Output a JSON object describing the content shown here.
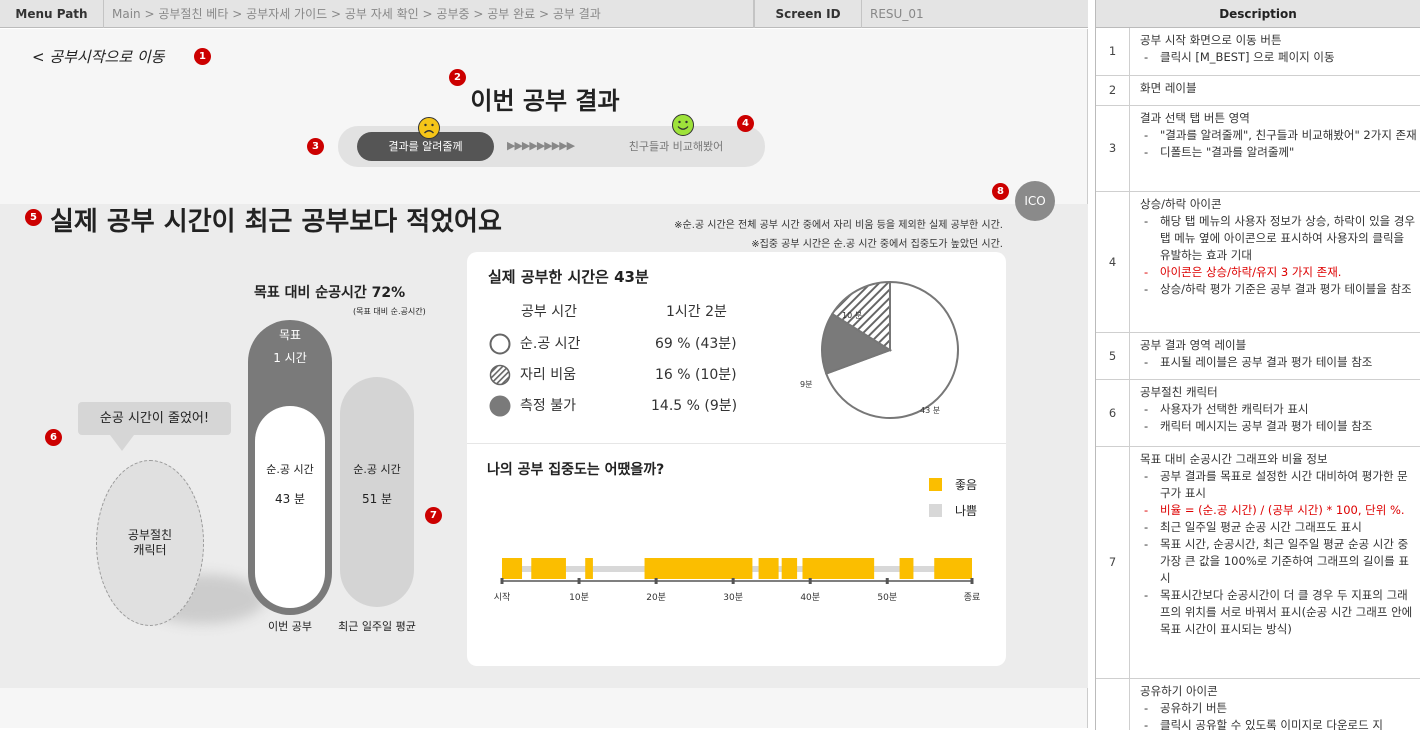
{
  "header": {
    "menu_path_label": "Menu Path",
    "menu_path": "Main > 공부절친 베타 > 공부자세 가이드 > 공부 자세 확인 > 공부중 > 공부 완료 > 공부 결과",
    "screen_id_label": "Screen ID",
    "screen_id": "RESU_01"
  },
  "screen": {
    "back_link": "< 공부시작으로 이동",
    "title": "이번 공부 결과",
    "tab_result": "결과를 알려줄께",
    "tab_arrows": "▶▶▶▶▶▶▶▶▶",
    "tab_compare": "친구들과 비교해봤어",
    "icon_label": "ICO",
    "result_heading": "실제 공부 시간이 최근 공부보다 적었어요",
    "note1": "※순.공 시간은 전체 공부 시간 중에서 자리 비움 등을 제외한 실제 공부한 시간.",
    "note2": "※집중 공부 시간은 순.공 시간 중에서 집중도가 높았던 시간.",
    "speech": "순공 시간이 줄었어!",
    "character": "공부절친\n캐릭터",
    "goal_ratio_prefix": "목표 대비 순공시간 ",
    "goal_ratio": "72%",
    "goal_ratio_sub": "(목표 대비 순.공시간)",
    "goal_label": "목표",
    "goal_value": "1 시간",
    "inner_label": "순.공 시간",
    "inner_value": "43 분",
    "avg_label": "순.공 시간",
    "avg_value": "51 분",
    "bar1_caption": "이번 공부",
    "bar2_caption": "최근 일주일 평균",
    "goal_ratio_value": 0.72,
    "actual_prefix": "실제 공부한 시간은 ",
    "actual_value": "43분",
    "study_time_label": "공부 시간",
    "study_time_value": "1시간 2분",
    "stats": [
      {
        "icon": "empty-circle",
        "label": "순.공 시간",
        "value": "69 % (43분)"
      },
      {
        "icon": "hatched-circle",
        "label": "자리 비움",
        "value": "16 % (10분)"
      },
      {
        "icon": "filled-circle",
        "label": "측정 불가",
        "value": "14.5 % (9분)"
      }
    ],
    "pie_labels": {
      "hatched": "10 분",
      "filled": "9분",
      "empty": "43 분"
    },
    "focus_heading": "나의 공부 집중도는 어땠을까?",
    "legend_good": "좋음",
    "legend_bad": "나쁨",
    "ticks": [
      "시작",
      "10분",
      "20분",
      "30분",
      "40분",
      "50분",
      "종료"
    ]
  },
  "colors": {
    "good": "#fbbe00",
    "bad": "#d8d8d8",
    "marker": "#cc0000",
    "dark": "#555555"
  },
  "chart_data": [
    {
      "type": "pie",
      "values": [
        43,
        10,
        9
      ],
      "categories": [
        "순.공 시간",
        "자리 비움",
        "측정 불가"
      ],
      "labels": [
        "43 분",
        "10 분",
        "9분"
      ]
    },
    {
      "type": "bar",
      "x_ticks": [
        "시작",
        "10분",
        "20분",
        "30분",
        "40분",
        "50분",
        "종료"
      ],
      "good_segments_min": [
        [
          0,
          2.6
        ],
        [
          3.8,
          8.3
        ],
        [
          10.8,
          11.8
        ],
        [
          18.5,
          32.5
        ],
        [
          33.3,
          35.9
        ],
        [
          36.3,
          38.3
        ],
        [
          39,
          48.3
        ],
        [
          51.6,
          53.4
        ],
        [
          56.1,
          61
        ]
      ]
    }
  ],
  "desc": {
    "header": "Description",
    "rows": [
      {
        "n": "1",
        "title": "공부 시작 화면으로 이동 버튼",
        "items": [
          {
            "t": "클릭시 [M_BEST] 으로 페이지 이동",
            "c": ""
          }
        ]
      },
      {
        "n": "2",
        "title": "화면 레이블",
        "items": []
      },
      {
        "n": "3",
        "title": "결과 선택 탭 버튼 영역",
        "items": [
          {
            "t": "\"결과를 알려줄께\", 친구들과 비교해봤어\" 2가지 존재",
            "c": ""
          },
          {
            "t": "디폴트는 \"결과를 알려줄께\"",
            "c": ""
          }
        ]
      },
      {
        "n": "4",
        "title": "상승/하락 아이콘",
        "items": [
          {
            "t": "해당 탭 메뉴의 사용자 정보가 상승, 하락이 있을 경우 탭 메뉴 옆에 아이콘으로 표시하여 사용자의 클릭을 유발하는 효과 기대",
            "c": ""
          },
          {
            "t": "아이콘은 상승/하락/유지 3 가지 존재.",
            "c": "red"
          },
          {
            "t": "상승/하락 평가 기준은 공부 결과 평가 테이블을 참조",
            "c": ""
          }
        ]
      },
      {
        "n": "5",
        "title": "공부 결과 영역 레이블",
        "items": [
          {
            "t": "표시될 레이블은 공부 결과 평가 테이블 참조",
            "c": ""
          }
        ]
      },
      {
        "n": "6",
        "title": "공부절친 캐릭터",
        "items": [
          {
            "t": "사용자가 선택한 캐릭터가 표시",
            "c": ""
          },
          {
            "t": "캐릭터 메시지는 공부 결과 평가 테이블 참조",
            "c": ""
          }
        ]
      },
      {
        "n": "7",
        "title": "목표 대비 순공시간 그래프와 비율 정보",
        "items": [
          {
            "t": "공부 결과를 목표로 설정한 시간 대비하여 평가한 문구가 표시",
            "c": ""
          },
          {
            "t": "비율 = (순.공 시간) / (공부 시간) * 100, 단위 %.",
            "c": "red"
          },
          {
            "t": "최근 일주일 평균 순공 시간 그래프도 표시",
            "c": ""
          },
          {
            "t": "목표 시간, 순공시간, 최근 일주일 평균 순공 시간 중 가장 큰 값을 100%로 기준하여 그래프의 길이를 표시",
            "c": ""
          },
          {
            "t": "목표시간보다 순공시간이 더 클 경우 두 지표의 그래프의 위치를 서로 바꿔서 표시(순공 시간 그래프 안에 목표 시간이 표시되는 방식)",
            "c": ""
          }
        ]
      },
      {
        "n": "",
        "title": "공유하기 아이콘",
        "items": [
          {
            "t": "공유하기 버튼",
            "c": ""
          },
          {
            "t": "클릭시 공유할 수 있도록 이미지로 다운로드 지",
            "c": ""
          }
        ]
      }
    ]
  }
}
